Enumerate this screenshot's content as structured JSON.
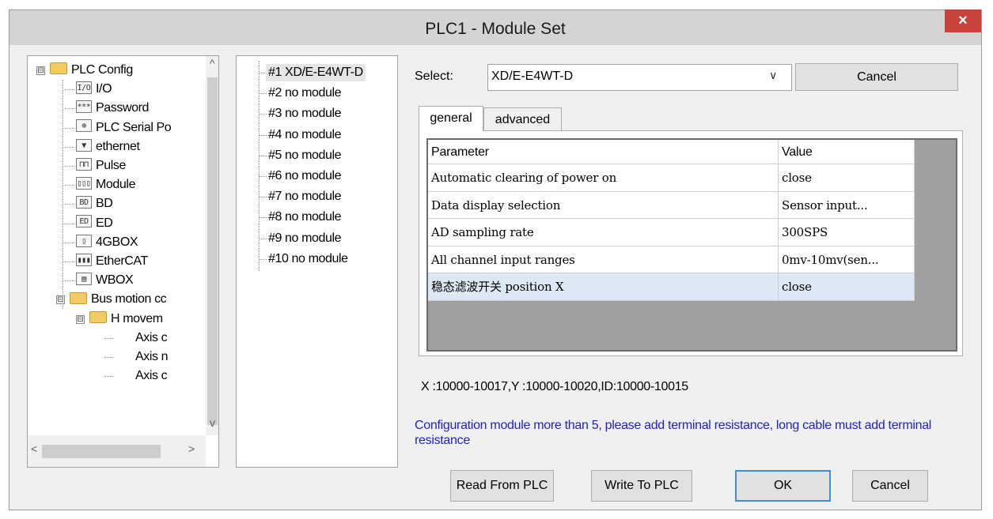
{
  "window": {
    "title": "PLC1 - Module  Set",
    "close": "×"
  },
  "tree": {
    "items": [
      {
        "label": "PLC Config",
        "icon": "folder-icon"
      },
      {
        "label": "I/O",
        "icon": "io-icon",
        "glyph": "I/O"
      },
      {
        "label": "Password",
        "icon": "password-icon",
        "glyph": "***"
      },
      {
        "label": "PLC Serial Po",
        "icon": "serial-port-icon",
        "glyph": "⊕"
      },
      {
        "label": "ethernet",
        "icon": "ethernet-icon",
        "glyph": "▼"
      },
      {
        "label": "Pulse",
        "icon": "pulse-icon",
        "glyph": "⊓⊓"
      },
      {
        "label": "Module",
        "icon": "module-icon",
        "glyph": "▯▯▯"
      },
      {
        "label": "BD",
        "icon": "bd-icon",
        "glyph": "BD"
      },
      {
        "label": "ED",
        "icon": "ed-icon",
        "glyph": "ED"
      },
      {
        "label": "4GBOX",
        "icon": "4gbox-icon",
        "glyph": "▯"
      },
      {
        "label": "EtherCAT",
        "icon": "ethercat-icon",
        "glyph": "▮▮▮"
      },
      {
        "label": "WBOX",
        "icon": "wbox-icon",
        "glyph": "▤"
      },
      {
        "label": "Bus motion cc",
        "icon": "folder-icon"
      },
      {
        "label": "H movem",
        "icon": "folder-icon"
      },
      {
        "label": "Axis c",
        "icon": "axis-icon"
      },
      {
        "label": "Axis n",
        "icon": "axis-icon"
      },
      {
        "label": "Axis c",
        "icon": "axis-icon"
      }
    ],
    "expand_symbol": "⊟",
    "scroll_up": "^",
    "scroll_down": "v",
    "scroll_left": "<",
    "scroll_right": ">"
  },
  "modules": [
    "#1 XD/E-E4WT-D",
    "#2 no module",
    "#3 no module",
    "#4 no module",
    "#5 no module",
    "#6 no module",
    "#7 no module",
    "#8 no module",
    "#9 no module",
    "#10 no module"
  ],
  "select": {
    "label": "Select:",
    "value": "XD/E-E4WT-D",
    "arrow": "∨"
  },
  "cancel_top": "Cancel",
  "tabs": {
    "general": "general",
    "advanced": "advanced"
  },
  "grid": {
    "headers": {
      "param": "Parameter",
      "value": "Value"
    },
    "rows": [
      {
        "param": "Automatic clearing of power on",
        "value": "close"
      },
      {
        "param": "Data display selection",
        "value": "Sensor input..."
      },
      {
        "param": "AD sampling rate",
        "value": "300SPS"
      },
      {
        "param": "All channel input ranges",
        "value": "0mv-10mv(sen..."
      },
      {
        "param": "稳态滤波开关 position X",
        "value": "close"
      }
    ]
  },
  "address_info": "X :10000-10017,Y :10000-10020,ID:10000-10015",
  "warning": "Configuration module more than 5, please add terminal resistance, long cable must add terminal resistance",
  "buttons": {
    "read": "Read From PLC",
    "write": "Write To PLC",
    "ok": "OK",
    "cancel": "Cancel"
  },
  "colors": {
    "warning_text": "#1f1fc8",
    "close_button": "#c7433b",
    "ok_border": "#3c8fd8",
    "selected_row": "#dce8f3"
  }
}
